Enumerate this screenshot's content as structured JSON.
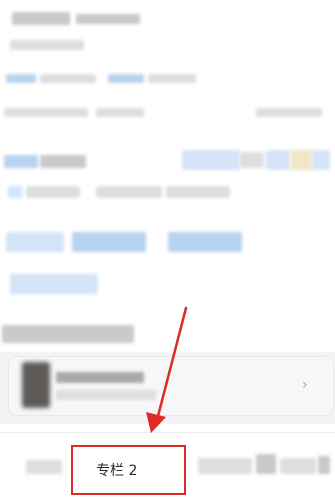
{
  "column_item": {
    "label": "专栏 2"
  },
  "card": {
    "chevron": "›"
  },
  "annotation": {
    "highlight_color": "#dc2a24"
  }
}
